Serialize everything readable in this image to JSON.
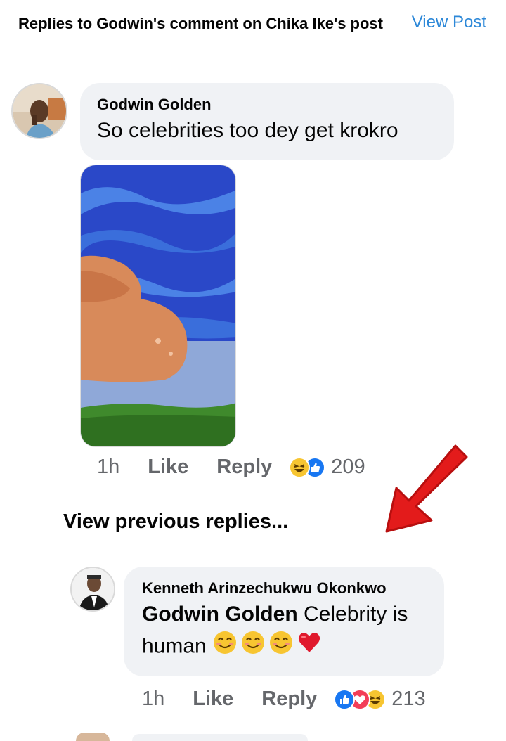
{
  "header": {
    "title": "Replies to Godwin's comment on Chika Ike's post",
    "view_post": "View Post"
  },
  "comment": {
    "author": "Godwin Golden",
    "text": "So celebrities too dey get krokro",
    "time": "1h",
    "like": "Like",
    "reply": "Reply",
    "reactions": [
      "laughing-emoji",
      "like-icon"
    ],
    "reaction_count": "209"
  },
  "view_previous": "View previous replies...",
  "reply": {
    "author": "Kenneth Arinzechukwu Okonkwo",
    "mention": "Godwin Golden",
    "text": " Celebrity is human",
    "emojis": [
      "smiling-emoji",
      "smiling-emoji",
      "smiling-emoji",
      "red-heart-emoji"
    ],
    "time": "1h",
    "like": "Like",
    "reply": "Reply",
    "reactions": [
      "like-icon",
      "love-icon",
      "laughing-emoji"
    ],
    "reaction_count": "213"
  },
  "colors": {
    "link": "#2d88d8",
    "bubble": "#f0f2f5",
    "muted": "#65676b",
    "arrow": "#e31b1b"
  }
}
